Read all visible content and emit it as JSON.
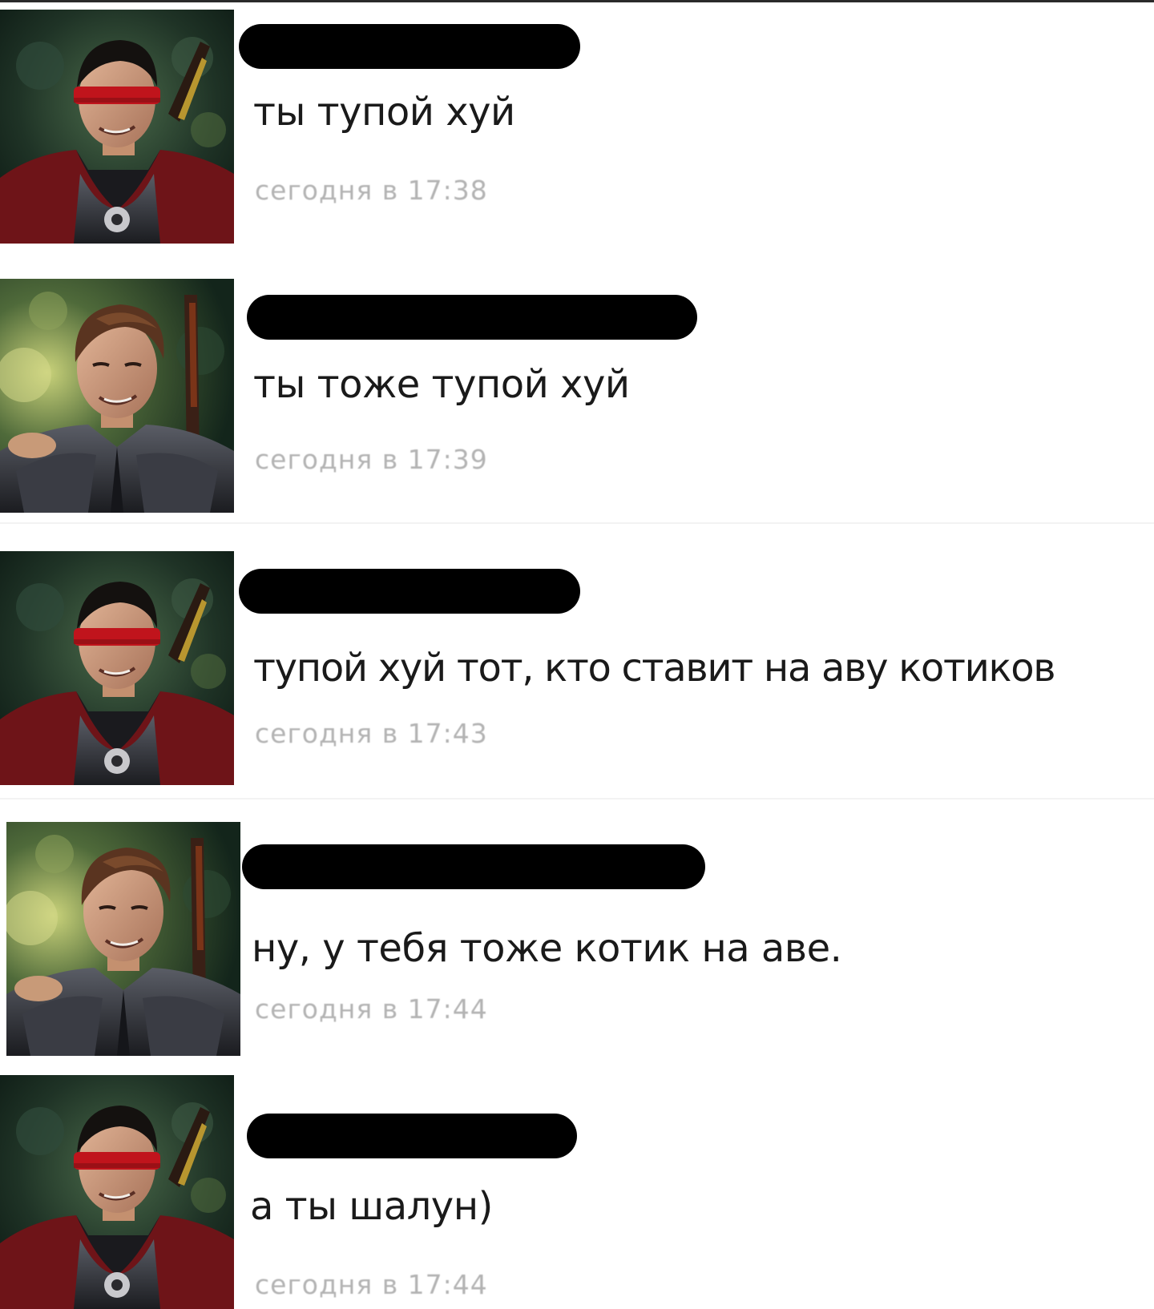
{
  "messages": [
    {
      "avatar": "blindfolded-man",
      "text": "ты тупой хуй",
      "time": "сегодня в 17:38"
    },
    {
      "avatar": "smiling-man",
      "text": "ты тоже тупой хуй",
      "time": "сегодня в 17:39"
    },
    {
      "avatar": "blindfolded-man",
      "text": "тупой хуй тот, кто ставит на аву котиков",
      "time": "сегодня в 17:43"
    },
    {
      "avatar": "smiling-man",
      "text": "ну, у тебя тоже котик на аве.",
      "time": "сегодня в 17:44"
    },
    {
      "avatar": "blindfolded-man",
      "text": "а ты шалун)",
      "time": "сегодня в 17:44"
    }
  ],
  "colors": {
    "redaction": "#000000",
    "text": "#1a1a1a",
    "timestamp": "#b3b3b3",
    "blindfold": "#c0141c",
    "armor_red": "#7a1418"
  }
}
